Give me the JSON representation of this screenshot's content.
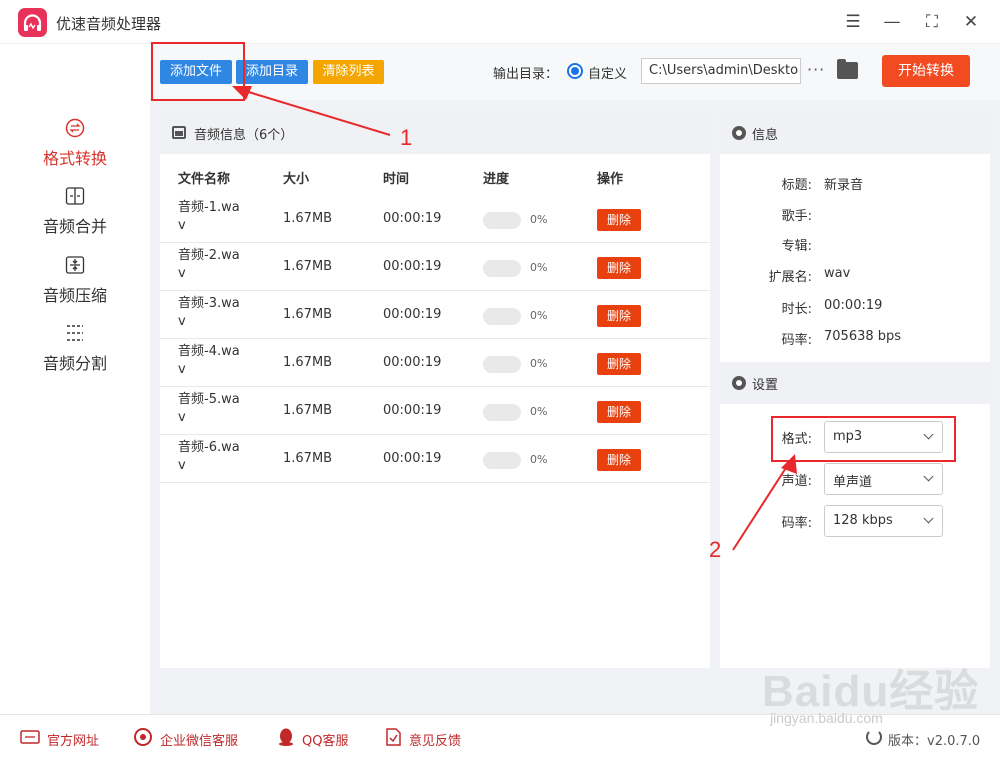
{
  "app": {
    "title": "优速音频处理器"
  },
  "window": {
    "menu_icon": "menu-icon",
    "min_icon": "minimize-icon",
    "max_icon": "maximize-icon",
    "close_icon": "close-icon"
  },
  "sidebar": {
    "items": [
      {
        "label": "格式转换",
        "icon": "convert-icon",
        "active": true
      },
      {
        "label": "音频合并",
        "icon": "merge-icon",
        "active": false
      },
      {
        "label": "音频压缩",
        "icon": "compress-icon",
        "active": false
      },
      {
        "label": "音频分割",
        "icon": "split-icon",
        "active": false
      }
    ]
  },
  "toolbar": {
    "add_file": "添加文件",
    "add_dir": "添加目录",
    "clear_list": "清除列表",
    "output_label": "输出目录：",
    "custom_label": "自定义",
    "path_value": "C:\\Users\\admin\\Deskto",
    "dots": "···",
    "start": "开始转换"
  },
  "list": {
    "title": "音频信息（6个）",
    "headers": {
      "name": "文件名称",
      "size": "大小",
      "time": "时间",
      "progress": "进度",
      "action": "操作"
    },
    "rows": [
      {
        "name": "音频-1.wav",
        "size": "1.67MB",
        "time": "00:00:19",
        "progress": "0%",
        "progress_value": 0,
        "action": "删除"
      },
      {
        "name": "音频-2.wav",
        "size": "1.67MB",
        "time": "00:00:19",
        "progress": "0%",
        "progress_value": 0,
        "action": "删除"
      },
      {
        "name": "音频-3.wav",
        "size": "1.67MB",
        "time": "00:00:19",
        "progress": "0%",
        "progress_value": 0,
        "action": "删除"
      },
      {
        "name": "音频-4.wav",
        "size": "1.67MB",
        "time": "00:00:19",
        "progress": "0%",
        "progress_value": 0,
        "action": "删除"
      },
      {
        "name": "音频-5.wav",
        "size": "1.67MB",
        "time": "00:00:19",
        "progress": "0%",
        "progress_value": 0,
        "action": "删除"
      },
      {
        "name": "音频-6.wav",
        "size": "1.67MB",
        "time": "00:00:19",
        "progress": "0%",
        "progress_value": 0,
        "action": "删除"
      }
    ]
  },
  "info": {
    "title": "信息",
    "fields": [
      {
        "label": "标题:",
        "value": "新录音"
      },
      {
        "label": "歌手:",
        "value": ""
      },
      {
        "label": "专辑:",
        "value": ""
      },
      {
        "label": "扩展名:",
        "value": "wav"
      },
      {
        "label": "时长:",
        "value": "00:00:19"
      },
      {
        "label": "码率:",
        "value": "705638 bps"
      }
    ]
  },
  "settings": {
    "title": "设置",
    "format_label": "格式:",
    "format_value": "mp3",
    "channel_label": "声道:",
    "channel_value": "单声道",
    "bitrate_label": "码率:",
    "bitrate_value": "128 kbps"
  },
  "footer": {
    "website": "官方网址",
    "wechat": "企业微信客服",
    "qq": "QQ客服",
    "feedback": "意见反馈",
    "version": "版本：v2.0.7.0"
  },
  "annotations": {
    "one": "1",
    "two": "2"
  },
  "watermark": {
    "main": "Baidu经验",
    "sub": "jingyan.baidu.com"
  },
  "colors": {
    "accent_red": "#d9342b",
    "blue": "#1a73e8",
    "orange_btn": "#f24a21",
    "delete": "#e8400e"
  }
}
